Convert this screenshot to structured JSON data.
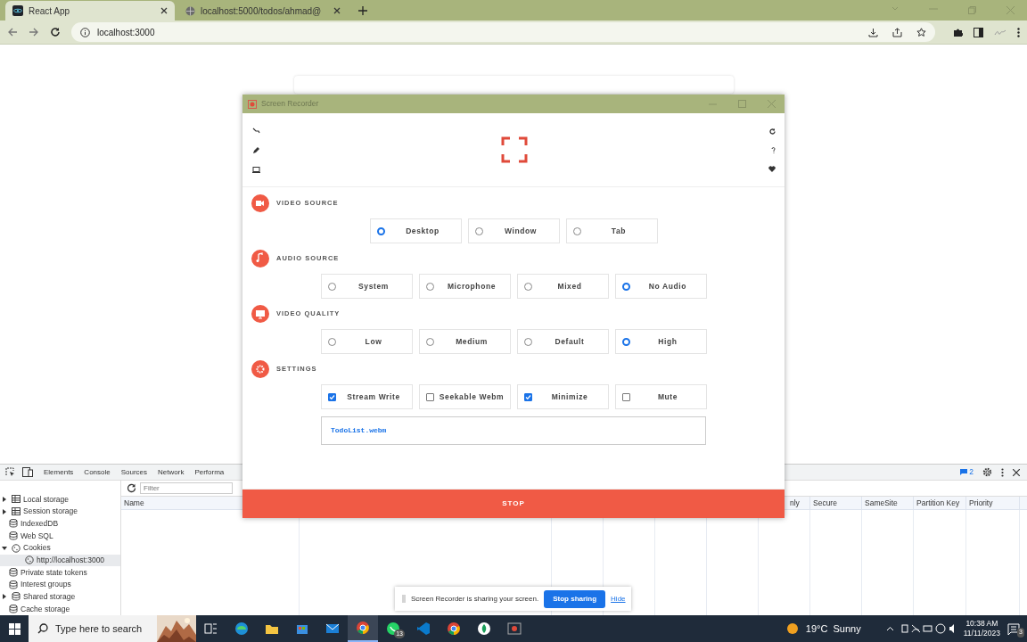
{
  "browser": {
    "tabs": [
      {
        "title": "React App",
        "selected": true
      },
      {
        "title": "localhost:5000/todos/ahmad@",
        "selected": false
      }
    ],
    "address": "localhost:3000"
  },
  "recorder": {
    "title": "Screen Recorder",
    "sections": [
      {
        "title": "VIDEO SOURCE",
        "kind": "radio",
        "options": [
          {
            "label": "Desktop",
            "selected": true
          },
          {
            "label": "Window",
            "selected": false
          },
          {
            "label": "Tab",
            "selected": false
          }
        ]
      },
      {
        "title": "AUDIO SOURCE",
        "kind": "radio",
        "options": [
          {
            "label": "System",
            "selected": false
          },
          {
            "label": "Microphone",
            "selected": false
          },
          {
            "label": "Mixed",
            "selected": false
          },
          {
            "label": "No Audio",
            "selected": true
          }
        ]
      },
      {
        "title": "VIDEO QUALITY",
        "kind": "radio",
        "options": [
          {
            "label": "Low",
            "selected": false
          },
          {
            "label": "Medium",
            "selected": false
          },
          {
            "label": "Default",
            "selected": false
          },
          {
            "label": "High",
            "selected": true
          }
        ]
      },
      {
        "title": "SETTINGS",
        "kind": "checkbox",
        "options": [
          {
            "label": "Stream Write",
            "checked": true
          },
          {
            "label": "Seekable Webm",
            "checked": false
          },
          {
            "label": "Minimize",
            "checked": true
          },
          {
            "label": "Mute",
            "checked": false
          }
        ]
      }
    ],
    "filename": "TodoList.webm",
    "stop_button": "STOP"
  },
  "devtools": {
    "tabs": [
      "Elements",
      "Console",
      "Sources",
      "Network",
      "Performa"
    ],
    "issues": "2",
    "tree": [
      {
        "label": "Local storage",
        "kind": "table",
        "expanded": false
      },
      {
        "label": "Session storage",
        "kind": "table",
        "expanded": false
      },
      {
        "label": "IndexedDB",
        "kind": "database"
      },
      {
        "label": "Web SQL",
        "kind": "database"
      },
      {
        "label": "Cookies",
        "kind": "cookie",
        "expanded": true,
        "children": [
          {
            "label": "http://localhost:3000",
            "kind": "cookie",
            "selected": true
          }
        ]
      },
      {
        "label": "Private state tokens",
        "kind": "database"
      },
      {
        "label": "Interest groups",
        "kind": "database"
      },
      {
        "label": "Shared storage",
        "kind": "database",
        "expanded": false
      },
      {
        "label": "Cache storage",
        "kind": "database"
      }
    ],
    "filter_placeholder": "Filter",
    "columns": [
      "Name",
      "nly",
      "Secure",
      "SameSite",
      "Partition Key",
      "Priority"
    ]
  },
  "share_bar": {
    "message": "Screen Recorder is sharing your screen.",
    "stop_button": "Stop sharing",
    "hide_link": "Hide"
  },
  "taskbar": {
    "search_placeholder": "Type here to search",
    "apps": [
      {
        "kind": "taskview",
        "active": false
      },
      {
        "kind": "globe",
        "active": false
      },
      {
        "kind": "folder",
        "active": false
      },
      {
        "kind": "bag",
        "active": false
      },
      {
        "kind": "mail",
        "active": false
      },
      {
        "kind": "chrome",
        "active": true
      },
      {
        "kind": "chat",
        "active": false,
        "badge": "13"
      },
      {
        "kind": "code",
        "active": false
      },
      {
        "kind": "chrome",
        "active": false
      },
      {
        "kind": "leaf",
        "active": false
      },
      {
        "kind": "record",
        "active": false
      }
    ],
    "weather": "19°C  Sunny",
    "time": "10:38 AM",
    "date": "11/11/2023",
    "notifications": "3"
  }
}
